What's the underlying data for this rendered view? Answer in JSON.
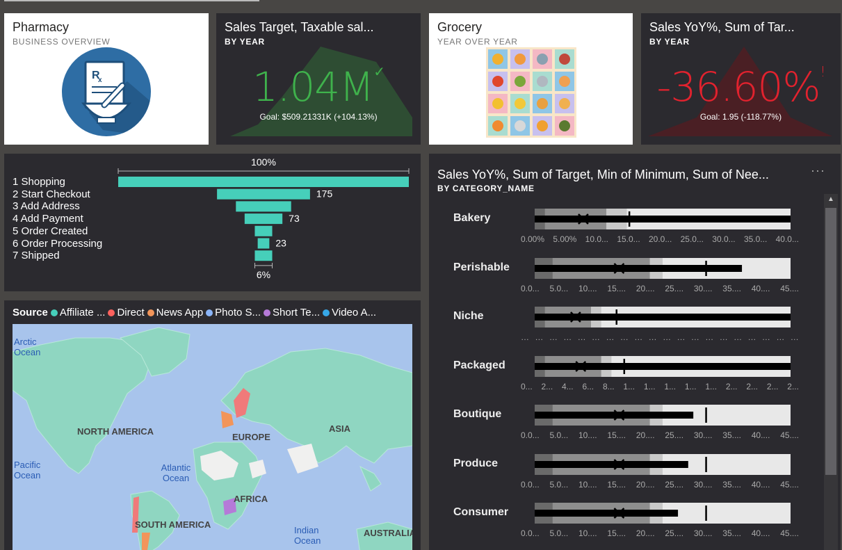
{
  "pharmacy": {
    "title": "Pharmacy",
    "subtitle": "BUSINESS OVERVIEW",
    "icon": "pharmacy-mortar-icon"
  },
  "kpi1": {
    "title": "Sales Target, Taxable sal...",
    "subtitle": "BY YEAR",
    "value": "1.04M",
    "goal": "Goal: $509.21331K (+104.13%)",
    "color": "#3fb24c",
    "status_icon": "check-icon"
  },
  "grocery": {
    "title": "Grocery",
    "subtitle": "YEAR OVER YEAR",
    "icon": "grocery-grid-icon"
  },
  "kpi2": {
    "title": "Sales YoY%, Sum of Tar...",
    "subtitle": "BY YEAR",
    "value": "-36.60%",
    "goal": "Goal: 1.95 (-118.77%)",
    "color": "#e2222e",
    "status_icon": "exclamation-icon"
  },
  "funnel": {
    "top_label": "100%",
    "bottom_label": "6%",
    "color": "#46cfba",
    "stages": [
      "1 Shopping",
      "2 Start Checkout",
      "3 Add Address",
      "4 Add Payment",
      "5 Order Created",
      "6 Order Processing",
      "7 Shipped"
    ],
    "value_labels": [
      "",
      "175",
      "",
      "73",
      "",
      "23",
      ""
    ],
    "fractions": [
      1.0,
      0.32,
      0.19,
      0.13,
      0.06,
      0.04,
      0.06
    ]
  },
  "mapcard": {
    "legend_title": "Source",
    "legend": [
      {
        "label": "Affiliate ...",
        "color": "#46cfba"
      },
      {
        "label": "Direct",
        "color": "#fd625e"
      },
      {
        "label": "News App",
        "color": "#f2955a"
      },
      {
        "label": "Photo S...",
        "color": "#8ab4f8"
      },
      {
        "label": "Short Te...",
        "color": "#b57ad8"
      },
      {
        "label": "Video A...",
        "color": "#37a8e8"
      }
    ],
    "ocean_labels": [
      "Arctic Ocean",
      "Pacific Ocean",
      "Atlantic Ocean",
      "Indian Ocean"
    ],
    "continent_labels": [
      "NORTH AMERICA",
      "EUROPE",
      "ASIA",
      "AFRICA",
      "SOUTH AMERICA",
      "AUSTRALIA"
    ]
  },
  "bullet": {
    "title": "Sales YoY%, Sum of Target, Min of Minimum, Sum of Nee...",
    "subtitle": "BY CATEGORY_NAME",
    "more_label": "···",
    "rows": [
      {
        "name": "Bakery",
        "ticks": [
          "0.00%",
          "5.00%",
          "10.0...",
          "15.0...",
          "20.0...",
          "25.0...",
          "30.0...",
          "35.0...",
          "40.0..."
        ],
        "value": 1.0,
        "marker": 0.19,
        "target": 0.37,
        "bands": [
          0.04,
          0.28,
          0.36
        ]
      },
      {
        "name": "Perishable",
        "ticks": [
          "0.0...",
          "5.0...",
          "10....",
          "15....",
          "20....",
          "25....",
          "30....",
          "35....",
          "40....",
          "45...."
        ],
        "value": 0.81,
        "marker": 0.33,
        "target": 0.67,
        "bands": [
          0.07,
          0.45,
          0.5
        ]
      },
      {
        "name": "Niche",
        "ticks": [
          "…",
          "…",
          "…",
          "…",
          "…",
          "…",
          "…",
          "…",
          "…",
          "…",
          "…",
          "…",
          "…",
          "…",
          "…",
          "…",
          "…",
          "…",
          "…",
          "…"
        ],
        "value": 1.0,
        "marker": 0.16,
        "target": 0.32,
        "bands": [
          0.04,
          0.22,
          0.26
        ]
      },
      {
        "name": "Packaged",
        "ticks": [
          "0...",
          "2...",
          "4...",
          "6...",
          "8...",
          "1...",
          "1...",
          "1...",
          "1...",
          "1...",
          "2...",
          "2...",
          "2...",
          "2..."
        ],
        "value": 1.0,
        "marker": 0.18,
        "target": 0.35,
        "bands": [
          0.04,
          0.26,
          0.3
        ]
      },
      {
        "name": "Boutique",
        "ticks": [
          "0.0...",
          "5.0...",
          "10....",
          "15....",
          "20....",
          "25....",
          "30....",
          "35....",
          "40....",
          "45...."
        ],
        "value": 0.62,
        "marker": 0.33,
        "target": 0.67,
        "bands": [
          0.07,
          0.45,
          0.5
        ]
      },
      {
        "name": "Produce",
        "ticks": [
          "0.0...",
          "5.0...",
          "10....",
          "15....",
          "20....",
          "25....",
          "30....",
          "35....",
          "40....",
          "45...."
        ],
        "value": 0.6,
        "marker": 0.33,
        "target": 0.67,
        "bands": [
          0.07,
          0.45,
          0.5
        ]
      },
      {
        "name": "Consumer",
        "ticks": [
          "0.0...",
          "5.0...",
          "10....",
          "15....",
          "20....",
          "25....",
          "30....",
          "35....",
          "40....",
          "45...."
        ],
        "value": 0.56,
        "marker": 0.33,
        "target": 0.67,
        "bands": [
          0.07,
          0.45,
          0.5
        ]
      }
    ]
  }
}
